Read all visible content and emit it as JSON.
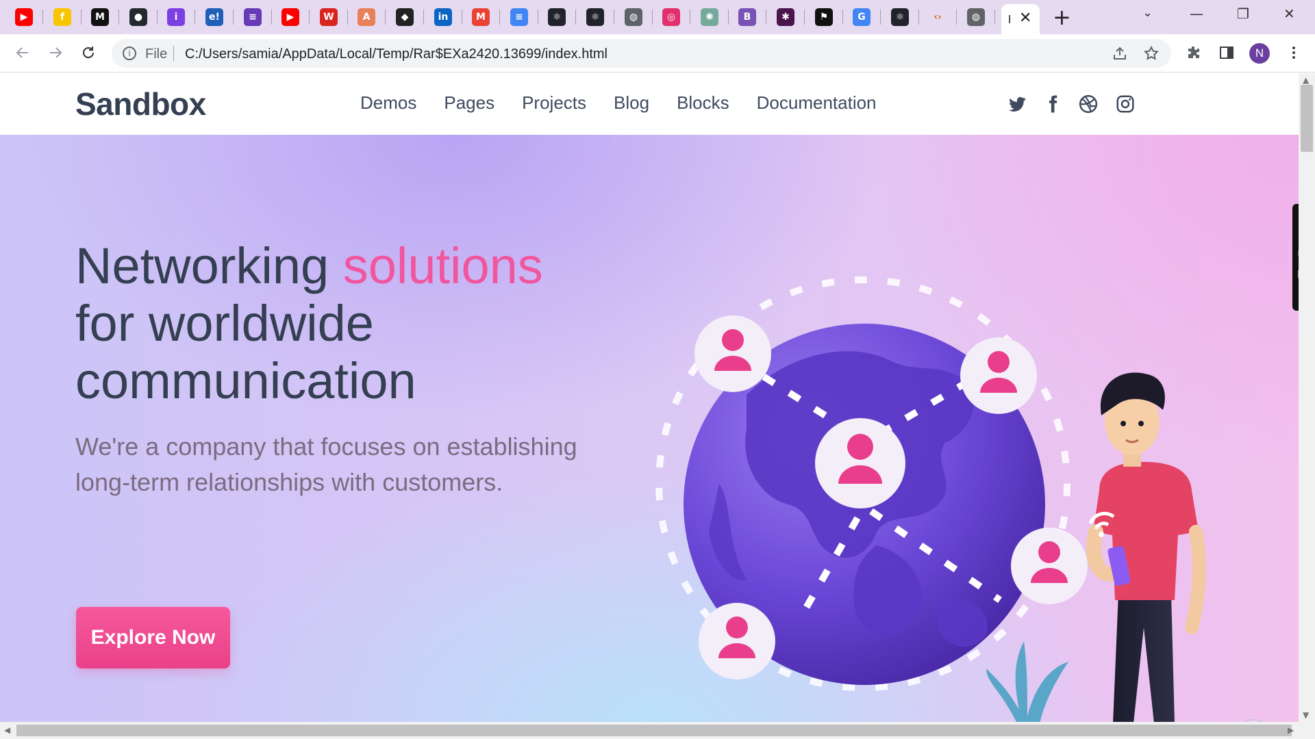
{
  "browser": {
    "tabs": [
      {
        "icon": "youtube-icon",
        "glyph": "▶",
        "bg": "#ff0000"
      },
      {
        "icon": "flipkart-icon",
        "glyph": "f",
        "bg": "#f7c600"
      },
      {
        "icon": "medium-icon",
        "glyph": "M",
        "bg": "#111111"
      },
      {
        "icon": "github-icon",
        "glyph": "●",
        "bg": "#24292f"
      },
      {
        "icon": "purple-circle-icon",
        "glyph": "i",
        "bg": "#7b3fe4"
      },
      {
        "icon": "e-icon",
        "glyph": "e!",
        "bg": "#1f5fb8"
      },
      {
        "icon": "forms-icon",
        "glyph": "≡",
        "bg": "#673ab7"
      },
      {
        "icon": "youtube-icon",
        "glyph": "▶",
        "bg": "#ff0000"
      },
      {
        "icon": "w-icon",
        "glyph": "W",
        "bg": "#d9251d"
      },
      {
        "icon": "a-icon",
        "glyph": "A",
        "bg": "#e8815a"
      },
      {
        "icon": "hexagon-icon",
        "glyph": "◆",
        "bg": "#222222"
      },
      {
        "icon": "linkedin-icon",
        "glyph": "in",
        "bg": "#0a66c2"
      },
      {
        "icon": "gmail-icon",
        "glyph": "M",
        "bg": "#ea4335"
      },
      {
        "icon": "docs-icon",
        "glyph": "≡",
        "bg": "#4285f4"
      },
      {
        "icon": "react-icon",
        "glyph": "⚛",
        "bg": "#20232a"
      },
      {
        "icon": "react-icon",
        "glyph": "⚛",
        "bg": "#20232a"
      },
      {
        "icon": "globe-icon",
        "glyph": "◍",
        "bg": "#5f6368"
      },
      {
        "icon": "instagram-icon",
        "glyph": "◎",
        "bg": "#e1306c"
      },
      {
        "icon": "chatgpt-icon",
        "glyph": "✺",
        "bg": "#74aa9c"
      },
      {
        "icon": "bootstrap-icon",
        "glyph": "B",
        "bg": "#7952b3"
      },
      {
        "icon": "slack-icon",
        "glyph": "✱",
        "bg": "#4a154b"
      },
      {
        "icon": "flag-icon",
        "glyph": "⚑",
        "bg": "#111111"
      },
      {
        "icon": "google-icon",
        "glyph": "G",
        "bg": "#4285f4"
      },
      {
        "icon": "react-icon",
        "glyph": "⚛",
        "bg": "#20232a"
      },
      {
        "icon": "code-icon",
        "glyph": "‹›",
        "bg": "#e6daf0"
      },
      {
        "icon": "globe-icon",
        "glyph": "◍",
        "bg": "#5f6368"
      }
    ],
    "address": {
      "scheme_label": "File",
      "url": "C:/Users/samia/AppData/Local/Temp/Rar$EXa2420.13699/index.html"
    },
    "profile_initial": "N",
    "accent": "#6a3fa0"
  },
  "page": {
    "logo": "Sandbox",
    "nav": [
      "Demos",
      "Pages",
      "Projects",
      "Blog",
      "Blocks",
      "Documentation"
    ],
    "social_icons": [
      "twitter-icon",
      "facebook-icon",
      "dribbble-icon",
      "instagram-icon"
    ],
    "hero": {
      "headline_part1": "Networking ",
      "headline_accent": "solutions",
      "headline_part2": "for worldwide communication",
      "subtitle": "We're a company that focuses on establishing long-term relationships with customers.",
      "cta_label": "Explore Now"
    },
    "colors": {
      "accent_pink": "#f0559e",
      "heading": "#343f52",
      "globe": "#6d4ad8"
    }
  }
}
